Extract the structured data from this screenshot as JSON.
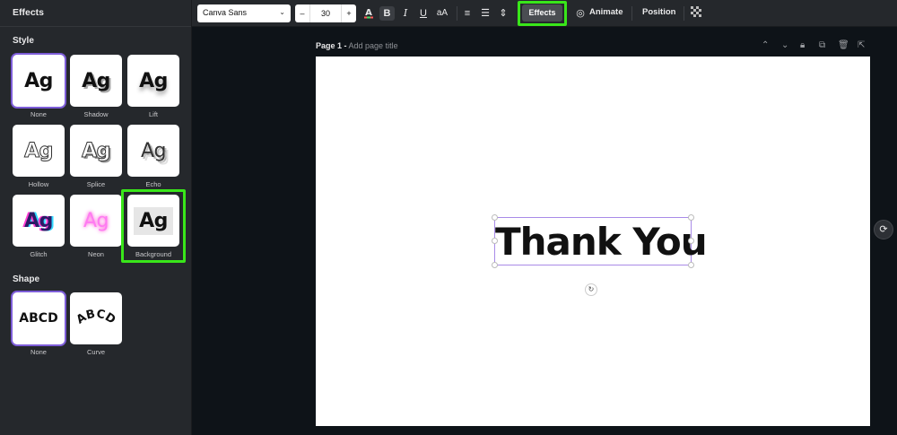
{
  "panel": {
    "title": "Effects",
    "style_title": "Style",
    "shape_title": "Shape",
    "styles": [
      {
        "label": "None",
        "sample": "Ag"
      },
      {
        "label": "Shadow",
        "sample": "Ag"
      },
      {
        "label": "Lift",
        "sample": "Ag"
      },
      {
        "label": "Hollow",
        "sample": "Ag"
      },
      {
        "label": "Splice",
        "sample": "Ag"
      },
      {
        "label": "Echo",
        "sample": "Ag"
      },
      {
        "label": "Glitch",
        "sample": "Ag"
      },
      {
        "label": "Neon",
        "sample": "Ag"
      },
      {
        "label": "Background",
        "sample": "Ag"
      }
    ],
    "shapes": [
      {
        "label": "None",
        "sample": "ABCD"
      },
      {
        "label": "Curve",
        "sample": "ABCD"
      }
    ]
  },
  "toolbar": {
    "font": "Canva Sans",
    "size_minus": "–",
    "size": "30",
    "size_plus": "+",
    "effects": "Effects",
    "animate": "Animate",
    "position": "Position"
  },
  "canvas": {
    "page_label": "Page 1 -",
    "page_placeholder": "Add page title",
    "text": "Thank You"
  },
  "colors": {
    "highlight": "#39e61a",
    "selection": "#7d5dd8",
    "panel_bg": "#25282c"
  }
}
